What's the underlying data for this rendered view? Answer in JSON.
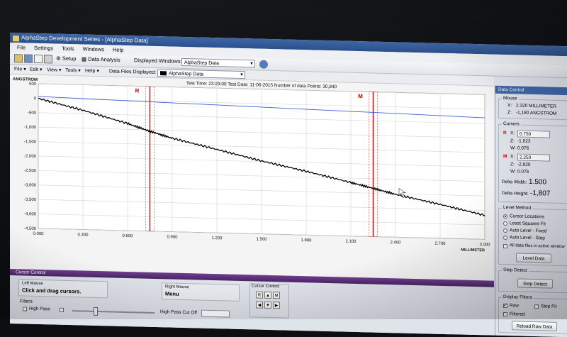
{
  "window": {
    "title": "AlphaStep Development Series - [AlphaStep Data]"
  },
  "menu": {
    "items": [
      "File",
      "Settings",
      "Tools",
      "Windows",
      "Help"
    ]
  },
  "toolbar": {
    "setup_label": "Setup",
    "data_analysis_label": "Data Analysis",
    "displayed_windows_label": "Displayed Windows:",
    "displayed_windows_value": "AlphaStep Data"
  },
  "subbar": {
    "items": [
      "File ▾",
      "Edit ▾",
      "View ▾",
      "Tools ▾",
      "Help ▾"
    ],
    "data_files_label": "Data Files Displayed:",
    "data_files_value": "AlphaStep Data"
  },
  "chart_header": {
    "y_unit": "ANGSTROM",
    "x_unit": "MILLIMETER",
    "info": "Test Time: 23:29:00  Test Date: 11-06-2015  Number of data Points: 30,840"
  },
  "cursor_labels": {
    "r": "R",
    "m": "M"
  },
  "chart_data": {
    "type": "line",
    "xlabel": "MILLIMETER",
    "ylabel": "ANGSTROM",
    "xlim": [
      0,
      3.0
    ],
    "ylim": [
      -4500,
      500
    ],
    "x_ticks": [
      "0.000",
      "0.300",
      "0.600",
      "0.900",
      "1.200",
      "1.500",
      "1.800",
      "2.100",
      "2.400",
      "2.700",
      "3.000"
    ],
    "y_ticks": [
      "500",
      "0",
      "-500",
      "-1,000",
      "-1,500",
      "-2,000",
      "-2,500",
      "-3,000",
      "-3,500",
      "-4,000",
      "-4,500"
    ],
    "series": [
      {
        "color": "#000000",
        "x": [
          0,
          0.3,
          0.6,
          0.75,
          0.9,
          1.2,
          1.5,
          1.8,
          2.1,
          2.25,
          2.4,
          2.7,
          3.0
        ],
        "y": [
          -10,
          -380,
          -800,
          -1050,
          -1270,
          -1620,
          -1980,
          -2300,
          -2650,
          -2830,
          -3020,
          -3330,
          -3670
        ]
      },
      {
        "color": "#3c5fd0",
        "x": [
          0,
          3.0
        ],
        "y": [
          60,
          -300
        ]
      }
    ],
    "cursors": [
      {
        "name": "R",
        "x": 0.75,
        "color": "#d00000"
      },
      {
        "name": "M",
        "x": 2.25,
        "color": "#d00000"
      }
    ],
    "grid": true
  },
  "right_panel": {
    "title": "Data Control",
    "mouse_group": "Mouse",
    "mouse_x_label": "X:",
    "mouse_x_value": "2.320  MILLIMETER",
    "mouse_z_label": "Z:",
    "mouse_z_value": "-1,180  ANGSTROM",
    "cursors_group": "Cursors",
    "r_x_value": "0.750",
    "r_z_value": "-1,023",
    "r_w_value": "0.076",
    "m_x_value": "2.250",
    "m_z_value": "-2,820",
    "m_w_value": "0.076",
    "delta_width_label": "Delta Width:",
    "delta_width_value": "1.500",
    "delta_height_label": "Delta Height:",
    "delta_height_value": "-1,807",
    "level_group": "Level Method",
    "level_options": [
      "Cursor Locations",
      "Least Squares Fit",
      "Auto Level - Fixed",
      "Auto Level - Step"
    ],
    "all_files_label": "All data files in active window",
    "level_data_button": "Level Data",
    "step_group": "Step Detect",
    "step_button": "Step Detect",
    "display_group": "Display Filters",
    "raw_label": "Raw",
    "step_fit_label": "Step Fit",
    "filtered_label": "Filtered",
    "reload_button": "Reload Raw Data"
  },
  "bottom": {
    "title": "Cursor Control",
    "left_mouse_label": "Left Mouse",
    "left_mouse_value": "Click and drag cursors.",
    "right_mouse_label": "Right Mouse",
    "right_mouse_value": "Menu",
    "cursor_control_label": "Cursor Control",
    "btn_r": "R",
    "btn_up": "▲",
    "btn_m": "M",
    "btn_left": "◀",
    "btn_down": "▼",
    "btn_right": "▶",
    "filters_label": "Filters",
    "high_pass_label": "High Pass",
    "high_pass_cutoff_label": "High Pass Cut Off"
  }
}
